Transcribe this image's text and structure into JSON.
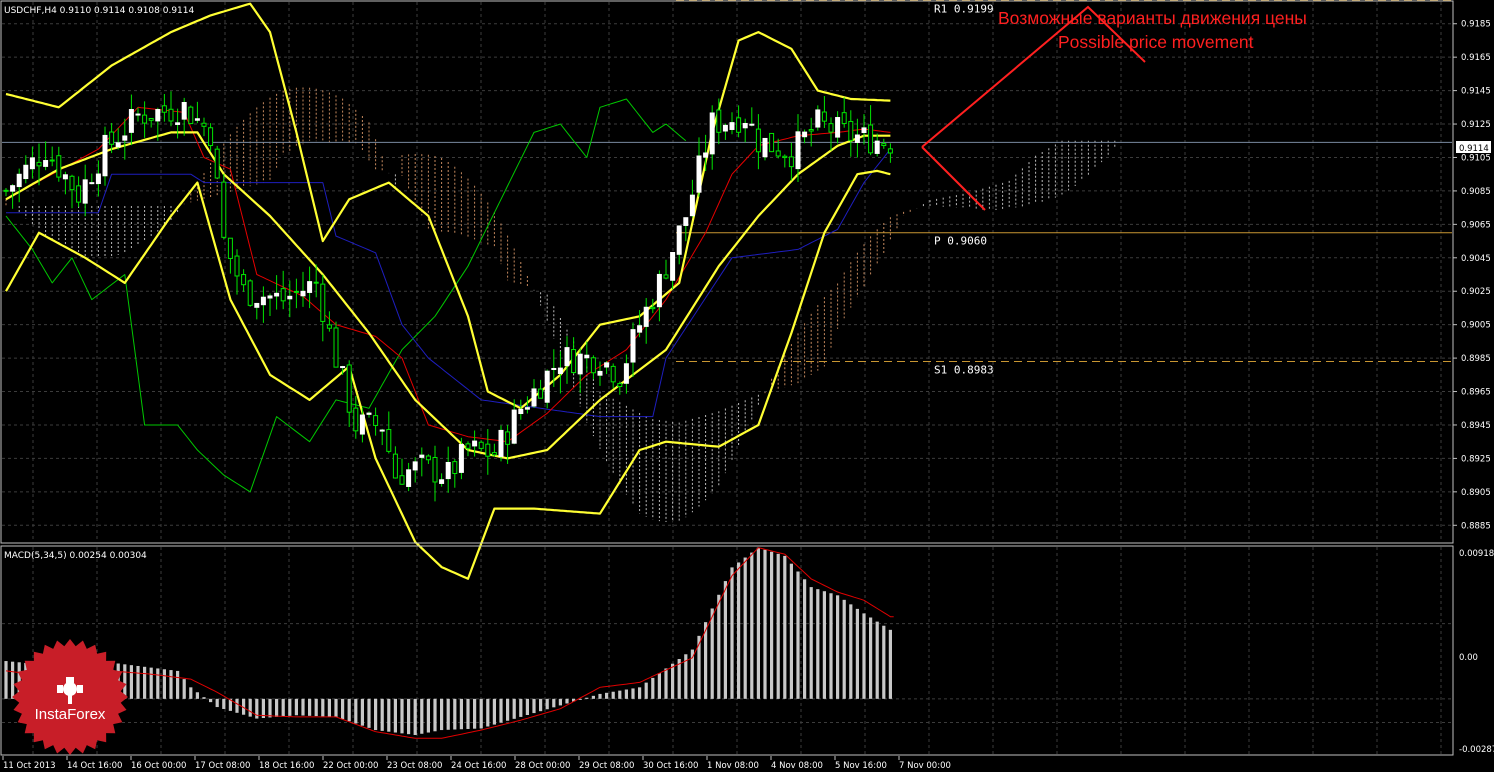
{
  "colors": {
    "background": "#000000",
    "grid": "#3c3c3c",
    "bullish_candle": "#ffffff",
    "bearish_candle": "#00e600",
    "bollinger": "#ffff33",
    "tenkan_sen": "#e60000",
    "kijun_sen": "#1e1ebe",
    "chikou_span": "#00c800",
    "cloud_bullish": "#dcdcdc",
    "cloud_bearish": "#e6a06e",
    "annotation": "#ff2020",
    "pivot_level": "#c89632",
    "macd_histogram": "#c8c8c8",
    "macd_signal": "#e00000",
    "logo": "#c81e28"
  },
  "main_header": "USDCHF,H4  0.9110 0.9114 0.9108 0.9114",
  "macd_header": "MACD(5,34,5) 0.00254 0.00304",
  "annotation": {
    "line_ru": "Возможные варианты движения цены",
    "line_en": "Possible price movement"
  },
  "levels": [
    {
      "label": "R1  0.9199",
      "price": 0.9199
    },
    {
      "label": "P  0.9060",
      "price": 0.906
    },
    {
      "label": "S1  0.8983",
      "price": 0.8983
    }
  ],
  "current_price_label": "0.9114",
  "logo_text": "InstaForex",
  "chart_data": {
    "type": "candlestick",
    "symbol": "USDCHF",
    "timeframe": "H4",
    "price_axis": {
      "range": [
        0.8875,
        0.9198
      ],
      "ticks": [
        "0.9185",
        "0.9165",
        "0.9145",
        "0.9125",
        "0.9105",
        "0.9085",
        "0.9065",
        "0.9045",
        "0.9025",
        "0.9005",
        "0.8985",
        "0.8965",
        "0.8945",
        "0.8925",
        "0.8905",
        "0.8885"
      ]
    },
    "macd_axis": {
      "range": [
        -0.00287,
        0.00918
      ],
      "ticks": [
        "0.00918",
        "0.00",
        "-0.00287"
      ]
    },
    "x_axis_labels": [
      "11 Oct 2013",
      "14 Oct 16:00",
      "16 Oct 00:00",
      "17 Oct 08:00",
      "18 Oct 16:00",
      "22 Oct 00:00",
      "23 Oct 08:00",
      "24 Oct 16:00",
      "28 Oct 00:00",
      "29 Oct 08:00",
      "30 Oct 16:00",
      "1 Nov 08:00",
      "4 Nov 08:00",
      "5 Nov 16:00",
      "7 Nov 00:00"
    ],
    "close_anchors": [
      [
        0,
        0.9085
      ],
      [
        6,
        0.911
      ],
      [
        11,
        0.9083
      ],
      [
        15,
        0.911
      ],
      [
        20,
        0.913
      ],
      [
        27,
        0.9135
      ],
      [
        31,
        0.912
      ],
      [
        33,
        0.9055
      ],
      [
        36,
        0.9025
      ],
      [
        42,
        0.902
      ],
      [
        47,
        0.903
      ],
      [
        50,
        0.8985
      ],
      [
        53,
        0.8945
      ],
      [
        57,
        0.8945
      ],
      [
        59,
        0.8915
      ],
      [
        63,
        0.892
      ],
      [
        67,
        0.8915
      ],
      [
        70,
        0.893
      ],
      [
        74,
        0.8928
      ],
      [
        78,
        0.8955
      ],
      [
        84,
        0.8985
      ],
      [
        90,
        0.8985
      ],
      [
        93,
        0.8975
      ],
      [
        96,
        0.9005
      ],
      [
        99,
        0.903
      ],
      [
        103,
        0.907
      ],
      [
        107,
        0.9125
      ],
      [
        112,
        0.913
      ],
      [
        114,
        0.9115
      ],
      [
        119,
        0.9108
      ],
      [
        123,
        0.9125
      ],
      [
        128,
        0.9118
      ],
      [
        134,
        0.9114
      ]
    ],
    "bollinger_upper": [
      [
        0,
        0.9143
      ],
      [
        8,
        0.9135
      ],
      [
        16,
        0.916
      ],
      [
        25,
        0.918
      ],
      [
        31,
        0.919
      ],
      [
        37,
        0.9197
      ],
      [
        40,
        0.918
      ],
      [
        44,
        0.912
      ],
      [
        48,
        0.9055
      ],
      [
        52,
        0.908
      ],
      [
        58,
        0.909
      ],
      [
        64,
        0.907
      ],
      [
        70,
        0.901
      ],
      [
        73,
        0.8965
      ],
      [
        78,
        0.8955
      ],
      [
        84,
        0.8975
      ],
      [
        90,
        0.9005
      ],
      [
        96,
        0.901
      ],
      [
        102,
        0.903
      ],
      [
        107,
        0.912
      ],
      [
        111,
        0.9175
      ],
      [
        114,
        0.918
      ],
      [
        119,
        0.917
      ],
      [
        123,
        0.9145
      ],
      [
        128,
        0.914
      ],
      [
        134,
        0.9139
      ]
    ],
    "bollinger_middle": [
      [
        0,
        0.908
      ],
      [
        8,
        0.9098
      ],
      [
        16,
        0.911
      ],
      [
        25,
        0.912
      ],
      [
        29,
        0.912
      ],
      [
        33,
        0.9095
      ],
      [
        40,
        0.907
      ],
      [
        48,
        0.9035
      ],
      [
        55,
        0.9
      ],
      [
        62,
        0.896
      ],
      [
        70,
        0.893
      ],
      [
        76,
        0.8925
      ],
      [
        82,
        0.893
      ],
      [
        90,
        0.896
      ],
      [
        100,
        0.899
      ],
      [
        108,
        0.904
      ],
      [
        114,
        0.907
      ],
      [
        120,
        0.9095
      ],
      [
        126,
        0.9112
      ],
      [
        130,
        0.9118
      ],
      [
        134,
        0.9118
      ]
    ],
    "bollinger_lower": [
      [
        0,
        0.9025
      ],
      [
        5,
        0.906
      ],
      [
        12,
        0.9045
      ],
      [
        18,
        0.903
      ],
      [
        25,
        0.907
      ],
      [
        29,
        0.909
      ],
      [
        34,
        0.902
      ],
      [
        40,
        0.8975
      ],
      [
        46,
        0.896
      ],
      [
        52,
        0.898
      ],
      [
        56,
        0.8925
      ],
      [
        62,
        0.8875
      ],
      [
        66,
        0.886
      ],
      [
        70,
        0.8853
      ],
      [
        74,
        0.8895
      ],
      [
        80,
        0.8895
      ],
      [
        90,
        0.8892
      ],
      [
        96,
        0.893
      ],
      [
        100,
        0.8935
      ],
      [
        108,
        0.8932
      ],
      [
        114,
        0.8945
      ],
      [
        119,
        0.9
      ],
      [
        124,
        0.906
      ],
      [
        129,
        0.9095
      ],
      [
        132,
        0.9097
      ],
      [
        134,
        0.9095
      ]
    ],
    "tenkan_sen": [
      [
        0,
        0.908
      ],
      [
        14,
        0.911
      ],
      [
        20,
        0.9135
      ],
      [
        27,
        0.9132
      ],
      [
        30,
        0.9105
      ],
      [
        34,
        0.9098
      ],
      [
        38,
        0.9035
      ],
      [
        45,
        0.9022
      ],
      [
        50,
        0.9005
      ],
      [
        56,
        0.8998
      ],
      [
        60,
        0.8985
      ],
      [
        64,
        0.8945
      ],
      [
        70,
        0.8938
      ],
      [
        76,
        0.8935
      ],
      [
        82,
        0.8952
      ],
      [
        88,
        0.8975
      ],
      [
        94,
        0.899
      ],
      [
        100,
        0.902
      ],
      [
        106,
        0.906
      ],
      [
        110,
        0.9095
      ],
      [
        114,
        0.9112
      ],
      [
        120,
        0.9118
      ],
      [
        126,
        0.912
      ],
      [
        130,
        0.9122
      ],
      [
        134,
        0.912
      ]
    ],
    "kijun_sen": [
      [
        0,
        0.9072
      ],
      [
        14,
        0.9072
      ],
      [
        16,
        0.9095
      ],
      [
        28,
        0.9095
      ],
      [
        30,
        0.909
      ],
      [
        48,
        0.909
      ],
      [
        50,
        0.9058
      ],
      [
        56,
        0.9048
      ],
      [
        60,
        0.9005
      ],
      [
        64,
        0.8985
      ],
      [
        72,
        0.896
      ],
      [
        90,
        0.895
      ],
      [
        98,
        0.895
      ],
      [
        100,
        0.8985
      ],
      [
        110,
        0.9045
      ],
      [
        120,
        0.905
      ],
      [
        126,
        0.9062
      ],
      [
        130,
        0.909
      ],
      [
        134,
        0.911
      ]
    ],
    "chikou_span": [
      [
        0,
        0.907
      ],
      [
        4,
        0.905
      ],
      [
        7,
        0.903
      ],
      [
        10,
        0.9045
      ],
      [
        13,
        0.902
      ],
      [
        18,
        0.9035
      ],
      [
        21,
        0.8945
      ],
      [
        26,
        0.8945
      ],
      [
        29,
        0.893
      ],
      [
        33,
        0.8915
      ],
      [
        37,
        0.8905
      ],
      [
        41,
        0.895
      ],
      [
        46,
        0.8935
      ],
      [
        50,
        0.896
      ],
      [
        55,
        0.8955
      ],
      [
        60,
        0.899
      ],
      [
        65,
        0.901
      ],
      [
        70,
        0.904
      ],
      [
        75,
        0.908
      ],
      [
        80,
        0.912
      ],
      [
        84,
        0.9125
      ],
      [
        88,
        0.9105
      ],
      [
        90,
        0.9135
      ],
      [
        94,
        0.914
      ],
      [
        98,
        0.912
      ],
      [
        100,
        0.9125
      ],
      [
        103,
        0.9115
      ]
    ],
    "macd_histogram": [
      [
        0,
        0.0023
      ],
      [
        8,
        0.002
      ],
      [
        16,
        0.0022
      ],
      [
        22,
        0.0019
      ],
      [
        26,
        0.0017
      ],
      [
        28,
        0.0007
      ],
      [
        32,
        -0.0005
      ],
      [
        38,
        -0.0012
      ],
      [
        44,
        -0.001
      ],
      [
        50,
        -0.0011
      ],
      [
        56,
        -0.0019
      ],
      [
        62,
        -0.0022
      ],
      [
        66,
        -0.0019
      ],
      [
        72,
        -0.0018
      ],
      [
        78,
        -0.0011
      ],
      [
        84,
        -0.0004
      ],
      [
        90,
        0.0003
      ],
      [
        96,
        0.0007
      ],
      [
        104,
        0.003
      ],
      [
        110,
        0.008
      ],
      [
        114,
        0.0092
      ],
      [
        118,
        0.0087
      ],
      [
        122,
        0.0068
      ],
      [
        126,
        0.0063
      ],
      [
        130,
        0.0052
      ],
      [
        134,
        0.0042
      ]
    ],
    "macd_signal": [
      [
        0,
        0.0017
      ],
      [
        8,
        0.0013
      ],
      [
        16,
        0.0017
      ],
      [
        22,
        0.0015
      ],
      [
        28,
        0.0012
      ],
      [
        32,
        0.0004
      ],
      [
        38,
        -0.001
      ],
      [
        44,
        -0.0011
      ],
      [
        50,
        -0.0011
      ],
      [
        56,
        -0.002
      ],
      [
        62,
        -0.0024
      ],
      [
        66,
        -0.0024
      ],
      [
        72,
        -0.0019
      ],
      [
        78,
        -0.0013
      ],
      [
        84,
        -0.0006
      ],
      [
        90,
        0.0007
      ],
      [
        96,
        0.001
      ],
      [
        104,
        0.0025
      ],
      [
        110,
        0.0075
      ],
      [
        114,
        0.0092
      ],
      [
        118,
        0.0088
      ],
      [
        122,
        0.0073
      ],
      [
        126,
        0.0065
      ],
      [
        130,
        0.006
      ],
      [
        134,
        0.005
      ]
    ]
  }
}
